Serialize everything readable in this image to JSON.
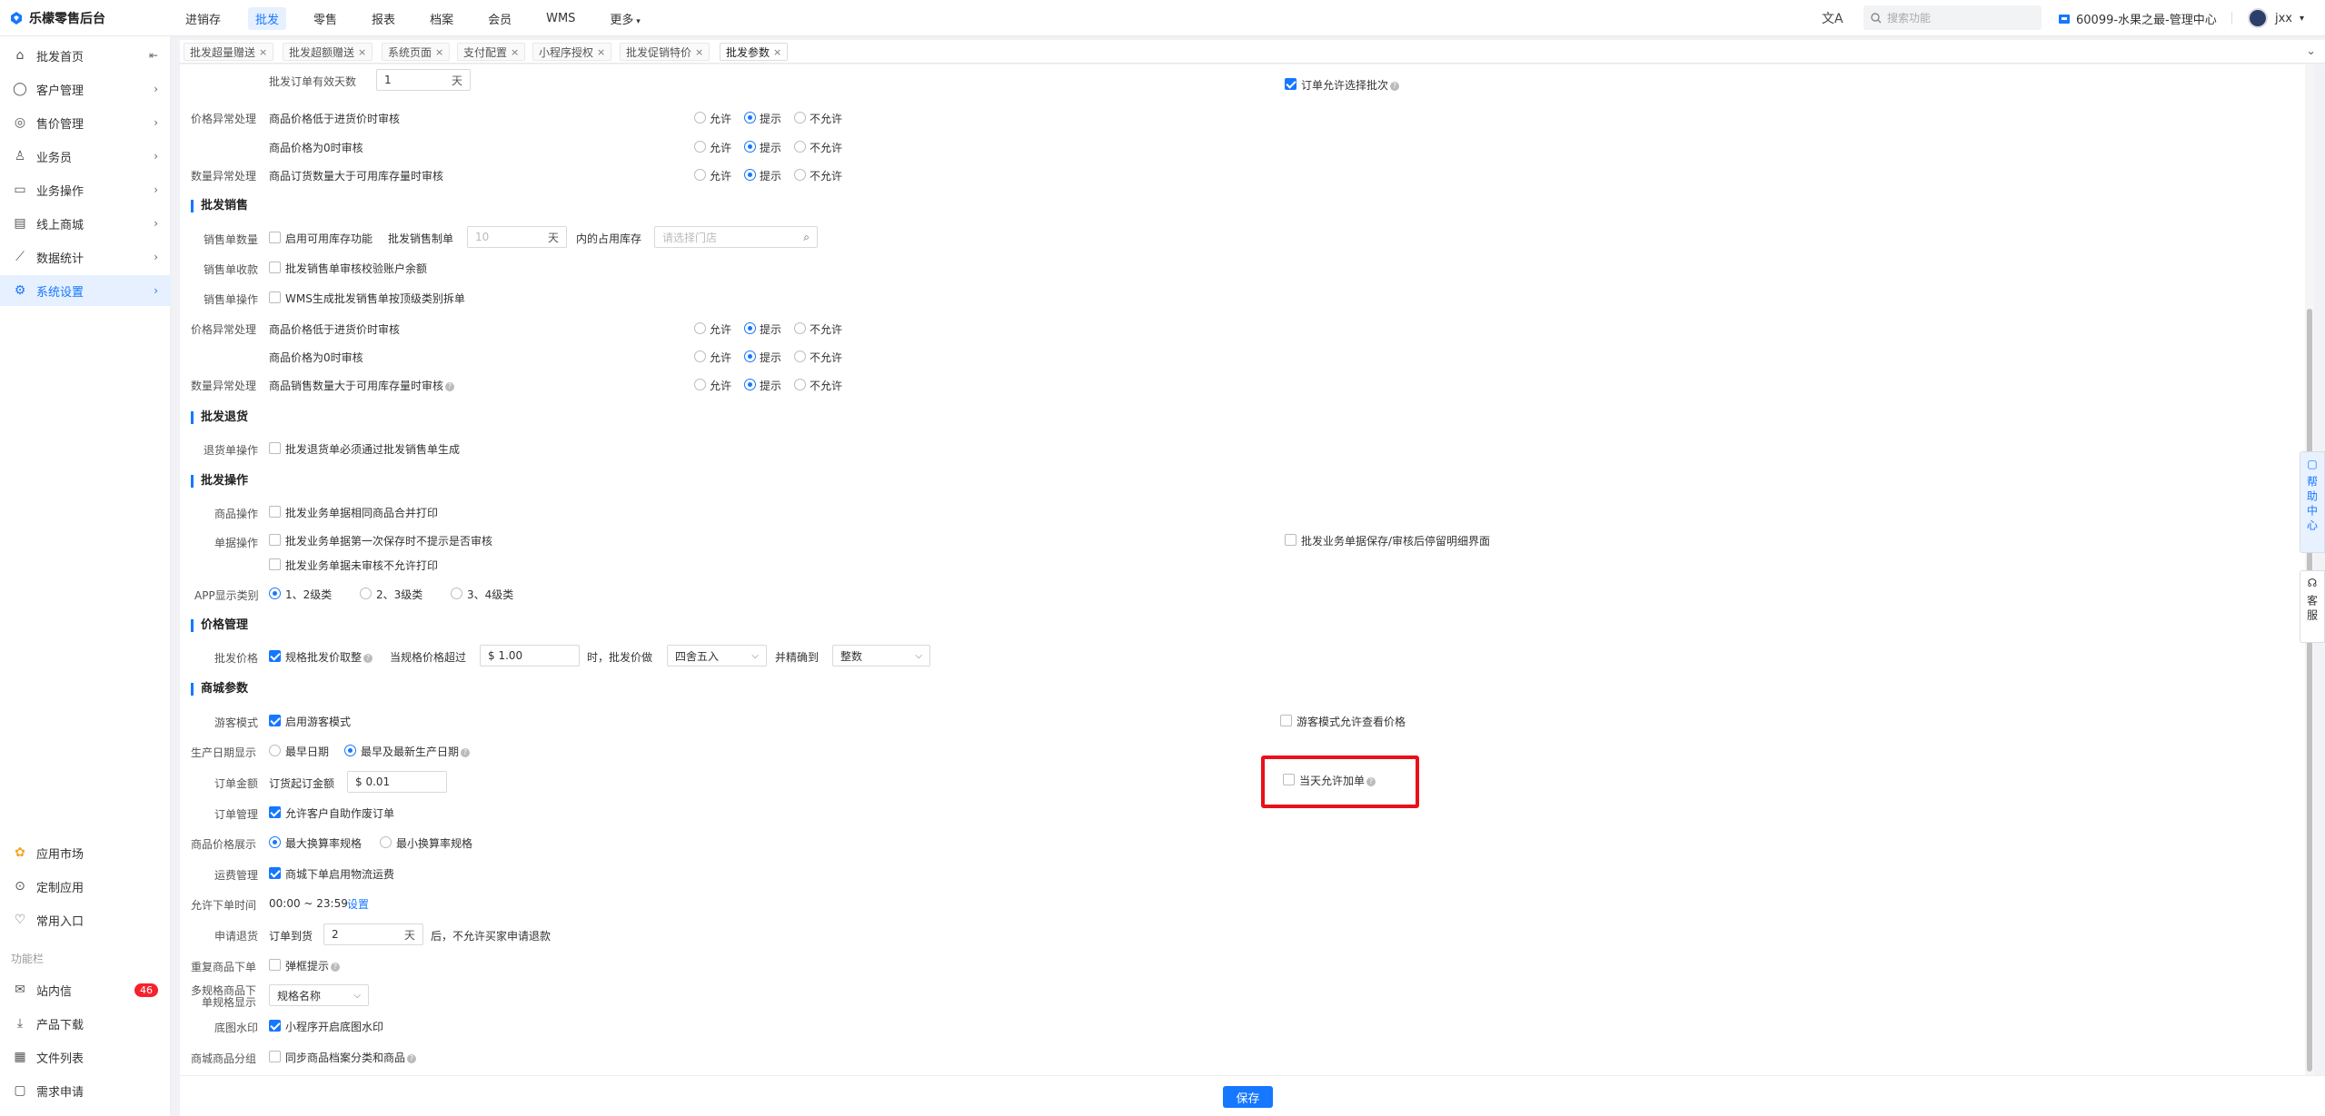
{
  "app": {
    "title": "乐檬零售后台"
  },
  "topnav": [
    "进销存",
    "批发",
    "零售",
    "报表",
    "档案",
    "会员",
    "WMS",
    "更多"
  ],
  "search": {
    "placeholder": "搜索功能"
  },
  "store": "60099-水果之最-管理中心",
  "user": "jxx",
  "sidebar": {
    "items": [
      "批发首页",
      "客户管理",
      "售价管理",
      "业务员",
      "业务操作",
      "线上商城",
      "数据统计",
      "系统设置"
    ],
    "bottom": [
      "应用市场",
      "定制应用",
      "常用入口"
    ],
    "function_label": "功能栏",
    "function_items": [
      "站内信",
      "产品下载",
      "文件列表",
      "需求申请"
    ],
    "badge": "46"
  },
  "tabs": [
    "批发超量赠送",
    "批发超额赠送",
    "系统页面",
    "支付配置",
    "小程序授权",
    "批发促销特价",
    "批发参数"
  ],
  "radio_opts": {
    "allow": "允许",
    "hint": "提示",
    "deny": "不允许"
  },
  "order": {
    "valid_days_label": "批发订单有效天数",
    "valid_days": "1",
    "unit_day": "天",
    "allow_batch": "订单允许选择批次",
    "price_abn": "价格异常处理",
    "price_below": "商品价格低于进货价时审核",
    "price_zero": "商品价格为0时审核",
    "qty_abn": "数量异常处理",
    "qty_exceed": "商品订货数量大于可用库存量时审核"
  },
  "sales": {
    "title": "批发销售",
    "qty_label": "销售单数量",
    "enable_stock": "启用可用库存功能",
    "sales_made": "批发销售制单",
    "days": "10",
    "occupied": "内的占用库存",
    "store_ph": "请选择门店",
    "collect_label": "销售单收款",
    "collect": "批发销售单审核校验账户余额",
    "op_label": "销售单操作",
    "op": "WMS生成批发销售单按顶级类别拆单",
    "price_abn": "价格异常处理",
    "price_below": "商品价格低于进货价时审核",
    "price_zero": "商品价格为0时审核",
    "qty_abn": "数量异常处理",
    "qty_exceed": "商品销售数量大于可用库存量时审核"
  },
  "returns": {
    "title": "批发退货",
    "op_label": "退货单操作",
    "op": "批发退货单必须通过批发销售单生成"
  },
  "operations": {
    "title": "批发操作",
    "goods_label": "商品操作",
    "goods": "批发业务单据相同商品合并打印",
    "doc_label": "单据操作",
    "doc1": "批发业务单据第一次保存时不提示是否审核",
    "doc2": "批发业务单据未审核不允许打印",
    "doc3": "批发业务单据保存/审核后停留明细界面",
    "app_label": "APP显示类别",
    "app1": "1、2级类",
    "app2": "2、3级类",
    "app3": "3、4级类"
  },
  "pricing": {
    "title": "价格管理",
    "label": "批发价格",
    "spec": "规格批发价取整",
    "when": "当规格价格超过",
    "amount": "$ 1.00",
    "then": "时，批发价做",
    "round": "四舍五入",
    "precision_label": "并精确到",
    "precision": "整数"
  },
  "mall": {
    "title": "商城参数",
    "guest_label": "游客模式",
    "guest": "启用游客模式",
    "guest_price": "游客模式允许查看价格",
    "date_label": "生产日期显示",
    "date1": "最早日期",
    "date2": "最早及最新生产日期",
    "amount_label": "订单金额",
    "min_amount": "订货起订金额",
    "min_value": "$ 0.01",
    "same_day": "当天允许加单",
    "order_mgmt_label": "订单管理",
    "order_mgmt": "允许客户自助作废订单",
    "price_show_label": "商品价格展示",
    "price_show1": "最大换算率规格",
    "price_show2": "最小换算率规格",
    "freight_label": "运费管理",
    "freight": "商城下单启用物流运费",
    "order_time_label": "允许下单时间",
    "order_time": "00:00 ~ 23:59",
    "set": "设置",
    "refund_label": "申请退货",
    "refund_pre": "订单到货",
    "refund_days": "2",
    "refund_post": "后，不允许买家申请退款",
    "dup_label": "重复商品下单",
    "dup": "弹框提示",
    "multi_label1": "多规格商品下",
    "multi_label2": "单规格显示",
    "multi_value": "规格名称",
    "watermark_label": "底图水印",
    "watermark": "小程序开启底图水印",
    "group_label": "商城商品分组",
    "group": "同步商品档案分类和商品"
  },
  "float": {
    "help": "帮助中心",
    "service": "客服"
  },
  "footer": {
    "save": "保存"
  }
}
